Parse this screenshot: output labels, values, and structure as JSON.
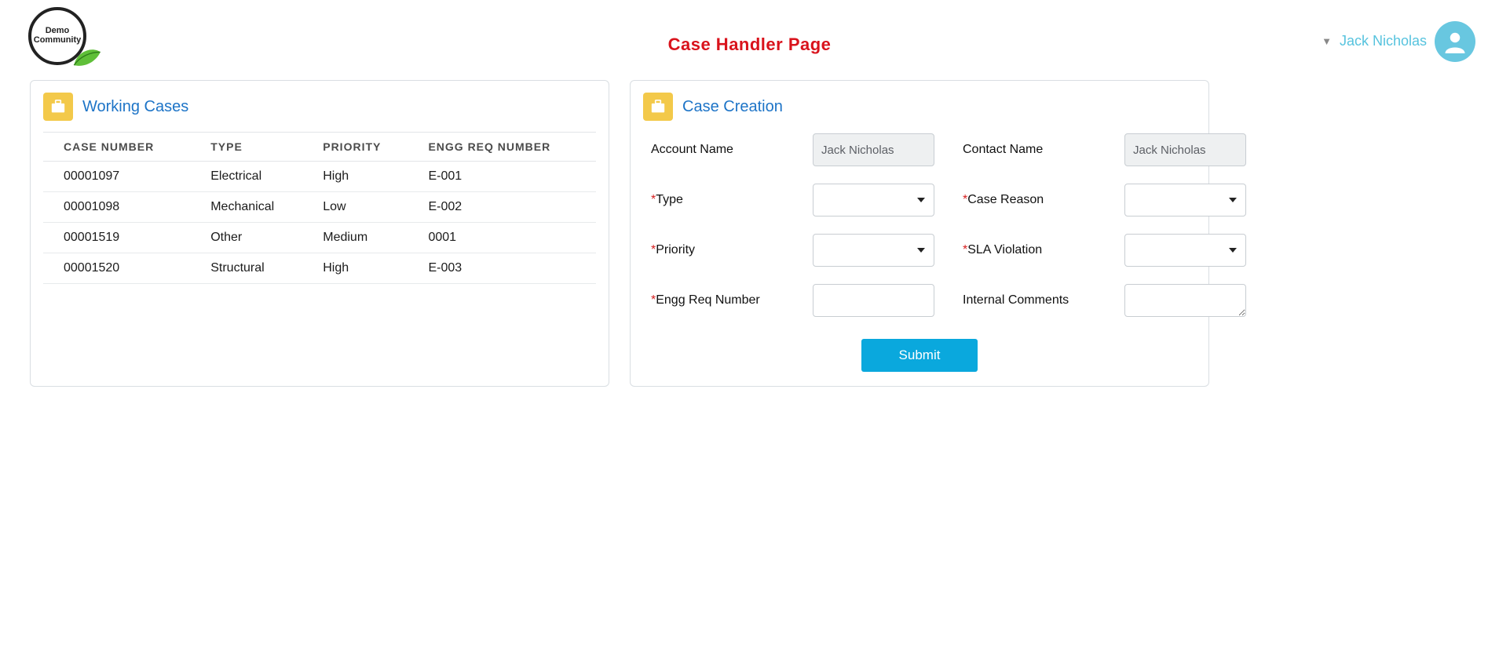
{
  "header": {
    "logo_text_top": "Demo",
    "logo_text_bottom": "Community",
    "page_title": "Case Handler Page",
    "user_name": "Jack Nicholas"
  },
  "working_cases": {
    "title": "Working Cases",
    "columns": [
      "CASE NUMBER",
      "TYPE",
      "PRIORITY",
      "ENGG REQ NUMBER"
    ],
    "rows": [
      {
        "case_number": "00001097",
        "type": "Electrical",
        "priority": "High",
        "engg": "E-001"
      },
      {
        "case_number": "00001098",
        "type": "Mechanical",
        "priority": "Low",
        "engg": "E-002"
      },
      {
        "case_number": "00001519",
        "type": "Other",
        "priority": "Medium",
        "engg": "0001"
      },
      {
        "case_number": "00001520",
        "type": "Structural",
        "priority": "High",
        "engg": "E-003"
      }
    ]
  },
  "case_creation": {
    "title": "Case Creation",
    "labels": {
      "account_name": "Account Name",
      "contact_name": "Contact Name",
      "type": "Type",
      "case_reason": "Case Reason",
      "priority": "Priority",
      "sla_violation": "SLA Violation",
      "engg_req_number": "Engg Req Number",
      "internal_comments": "Internal Comments"
    },
    "values": {
      "account_name": "Jack Nicholas",
      "contact_name": "Jack Nicholas",
      "type": "",
      "case_reason": "",
      "priority": "",
      "sla_violation": "",
      "engg_req_number": "",
      "internal_comments": ""
    },
    "submit_label": "Submit"
  }
}
